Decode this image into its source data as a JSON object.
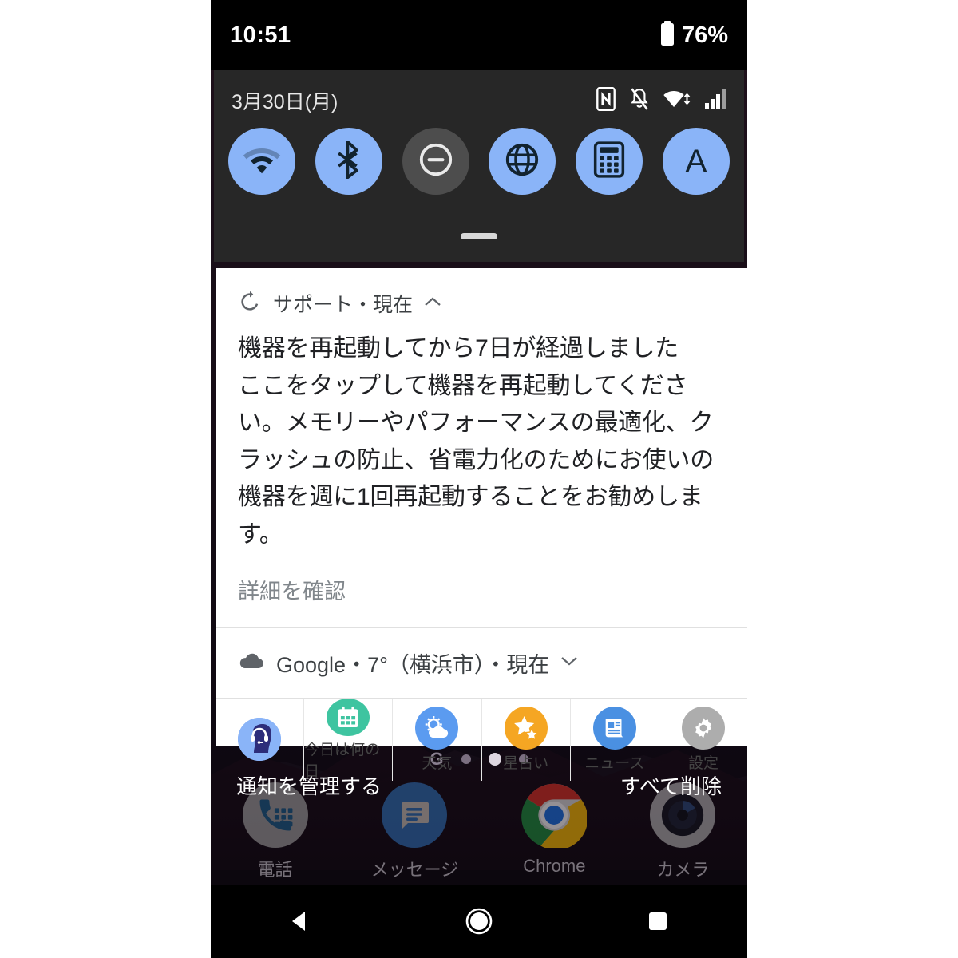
{
  "status_bar": {
    "time": "10:51",
    "battery_percent": "76%",
    "battery_icon": "battery-icon"
  },
  "quick_settings": {
    "date": "3月30日(月)",
    "system_icons": [
      "nfc-icon",
      "notifications-muted-icon",
      "wifi-icon",
      "cellular-signal-icon"
    ],
    "tiles": [
      {
        "name": "wifi-tile",
        "icon": "wifi-icon",
        "state": "on"
      },
      {
        "name": "bluetooth-tile",
        "icon": "bluetooth-icon",
        "state": "on"
      },
      {
        "name": "do-not-disturb-tile",
        "icon": "do-not-disturb-icon",
        "state": "off"
      },
      {
        "name": "internet-tile",
        "icon": "globe-icon",
        "state": "on"
      },
      {
        "name": "calculator-tile",
        "icon": "calculator-icon",
        "state": "on"
      },
      {
        "name": "auto-rotate-tile",
        "icon": "letter-a-icon",
        "state": "on"
      }
    ],
    "handle": "drag-handle"
  },
  "notification": {
    "app_label": "サポート・現在",
    "header_icon": "restart-icon",
    "collapse_icon": "chevron-up-icon",
    "title": "機器を再起動してから7日が経過しました",
    "body": "ここをタップして機器を再起動してください。メモリーやパフォーマンスの最適化、クラッシュの防止、省電力化のためにお使いの機器を週に1回再起動することをお勧めします。",
    "link_label": "詳細を確認"
  },
  "weather_notification": {
    "icon": "cloud-icon",
    "text": "Google・7°（横浜市）・現在",
    "expand_icon": "chevron-down-icon"
  },
  "shortcuts": [
    {
      "label": "",
      "icon": "support-agent-icon",
      "color": "#8ab4f8"
    },
    {
      "label": "今日は何の日",
      "icon": "calendar-icon",
      "color": "#3ec4a0"
    },
    {
      "label": "天気",
      "icon": "weather-sun-cloud-icon",
      "color": "#5b9bf0"
    },
    {
      "label": "星占い",
      "icon": "star-icon",
      "color": "#f5a623"
    },
    {
      "label": "ニュース",
      "icon": "news-icon",
      "color": "#4a90e2"
    },
    {
      "label": "設定",
      "icon": "gear-icon",
      "color": "#adadad"
    }
  ],
  "page_indicator": {
    "google_logo": "G",
    "dots": 3,
    "active_index": 1
  },
  "shade_actions": {
    "manage": "通知を管理する",
    "clear_all": "すべて削除"
  },
  "dock": [
    {
      "label": "電話",
      "icon": "phone-icon"
    },
    {
      "label": "メッセージ",
      "icon": "message-icon"
    },
    {
      "label": "Chrome",
      "icon": "chrome-icon"
    },
    {
      "label": "カメラ",
      "icon": "camera-icon"
    }
  ],
  "nav_bar": {
    "back": "back-icon",
    "home": "home-icon",
    "recents": "recents-icon"
  },
  "colors": {
    "accent_tile": "#8ab4f8",
    "panel_bg": "#272727",
    "card_bg": "#ffffff"
  }
}
